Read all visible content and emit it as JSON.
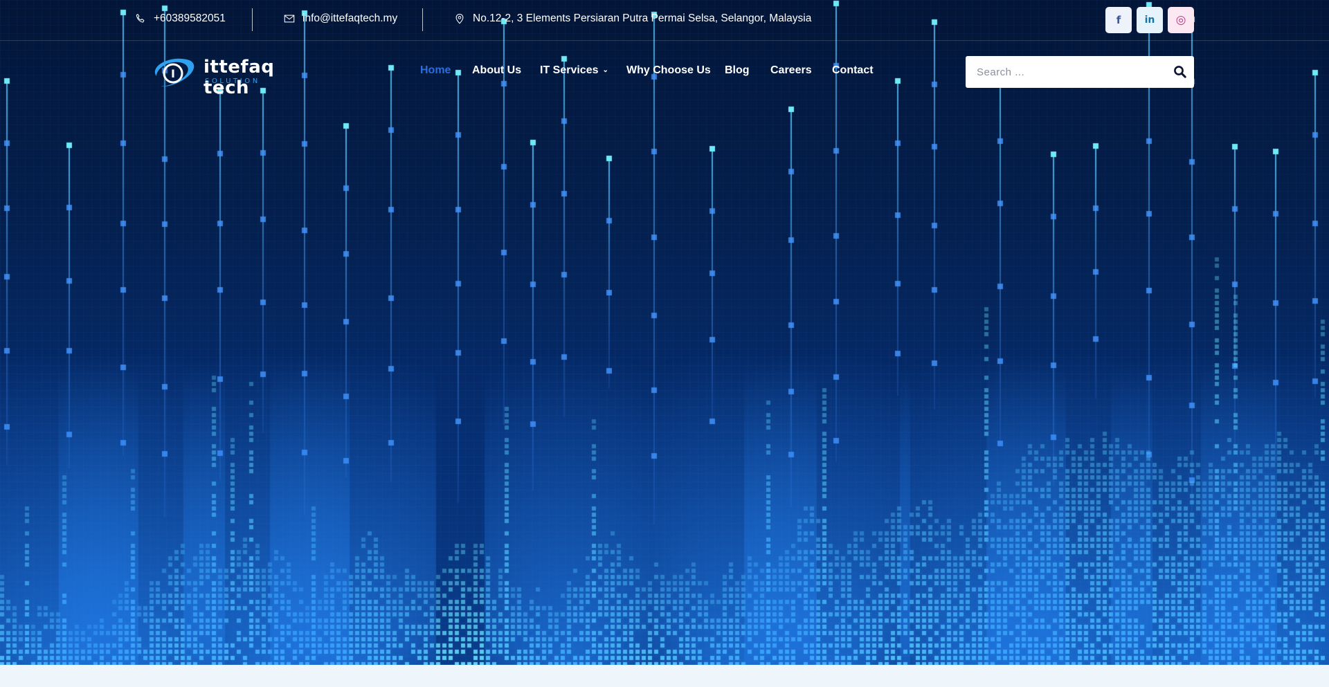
{
  "topbar": {
    "phone": "+60389582051",
    "email": "info@ittefaqtech.my",
    "address": "No.12-2, 3 Elements Persiaran Putra Permai Selsa, Selangor, Malaysia",
    "icons": {
      "phone": "phone-icon",
      "email": "envelope-icon",
      "address": "map-pin-icon"
    },
    "social": [
      {
        "name": "facebook",
        "glyph": "f",
        "color": "#3b5998"
      },
      {
        "name": "linkedin",
        "glyph": "in",
        "color": "#0e76a8"
      },
      {
        "name": "instagram",
        "glyph": "◎",
        "color": "#c13584"
      }
    ]
  },
  "logo": {
    "title": "ittefaq tech",
    "subtitle": "SOLUTION",
    "mark": "I"
  },
  "nav": {
    "items": [
      {
        "label": "Home",
        "active": true
      },
      {
        "label": "About Us"
      },
      {
        "label": "IT Services",
        "dropdown": true
      },
      {
        "label": "Why Choose Us"
      },
      {
        "label": "Blog"
      },
      {
        "label": "Careers"
      },
      {
        "label": "Contact"
      }
    ],
    "dropdown_glyph": "⌄"
  },
  "search": {
    "placeholder": "Search ...",
    "icon": "search-icon"
  },
  "colors": {
    "accent": "#2b6de0",
    "bg_dark": "#031537",
    "glow": "#4fd8f2"
  }
}
